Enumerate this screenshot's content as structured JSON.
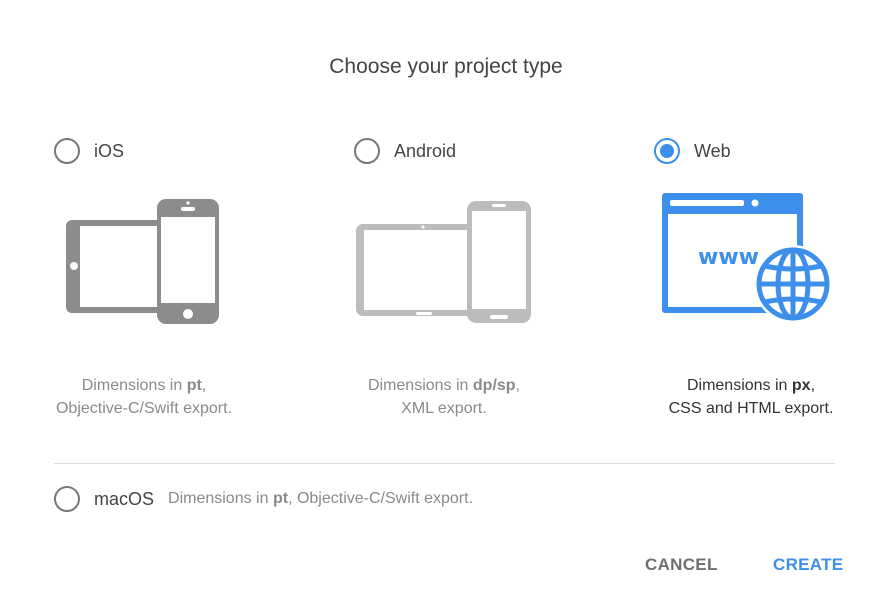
{
  "dialog": {
    "title": "Choose your project type"
  },
  "options": {
    "ios": {
      "label": "iOS",
      "checked": false,
      "desc_prefix": "Dimensions in ",
      "desc_unit": "pt",
      "desc_suffix": ",",
      "desc_line2": "Objective-C/Swift export."
    },
    "android": {
      "label": "Android",
      "checked": false,
      "desc_prefix": "Dimensions in ",
      "desc_unit": "dp/sp",
      "desc_suffix": ",",
      "desc_line2": "XML export."
    },
    "web": {
      "label": "Web",
      "checked": true,
      "desc_prefix": "Dimensions in ",
      "desc_unit": "px",
      "desc_suffix": ",",
      "desc_line2": "CSS and HTML export.",
      "illustration_text": "www"
    },
    "macos": {
      "label": "macOS",
      "checked": false,
      "desc_prefix": "Dimensions in ",
      "desc_unit": "pt",
      "desc_suffix": ", Objective-C/Swift export."
    }
  },
  "buttons": {
    "cancel": "CANCEL",
    "create": "CREATE"
  },
  "colors": {
    "accent": "#3d8fec",
    "ios_device": "#8e8b8e",
    "android_device": "#bdbbbc"
  }
}
